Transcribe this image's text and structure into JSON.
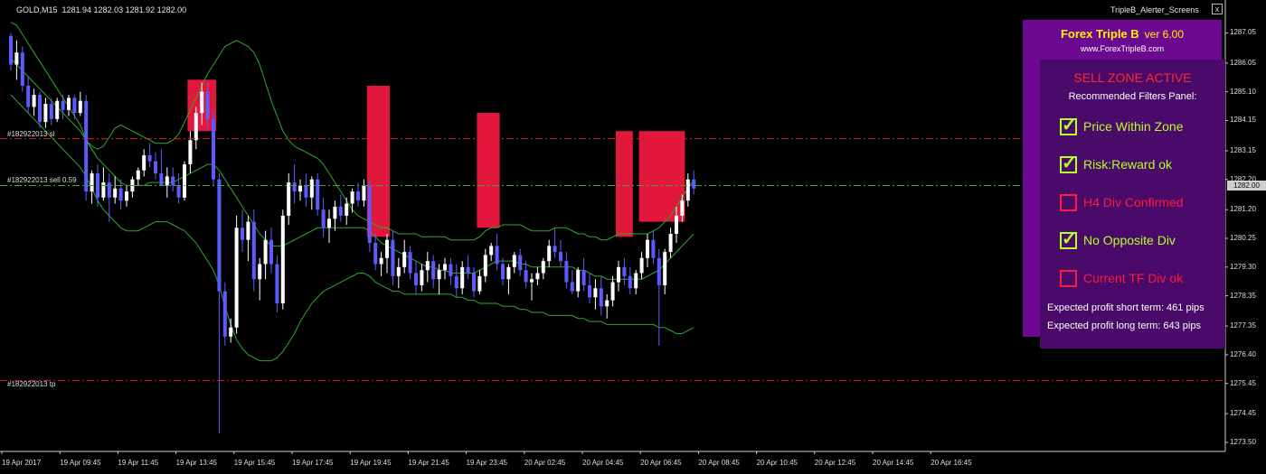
{
  "window": {
    "symbol_info": "GOLD,M15  1281.94 1282.03 1281.92 1282.00",
    "indicator_name": "TripleB_Alerter_Screens",
    "close_label": "x"
  },
  "colors": {
    "background": "#000000",
    "grid_axis": "#cccccc",
    "bull_candle": "#ffffff",
    "bear_candle": "#5b5bff",
    "bollinger": "#2ea82e",
    "sell_zone": "#e3173b",
    "sl_line": "#d62020",
    "entry_line": "#3fa33f",
    "tp_line": "#d62020",
    "panel_header_bg": "#6b0a91",
    "panel_body_bg": "#4a0a6a",
    "active_filter": "#b4ff2a",
    "inactive_filter": "#ff1a3a"
  },
  "orders": {
    "sl_label": "#182922013 sl",
    "entry_label": "#182922013 sell 0.59",
    "tp_label": "#182922013 tp"
  },
  "panel": {
    "title": "Forex Triple B",
    "version": "ver 6.00",
    "website": "www.ForexTripleB.com",
    "zone_status": "SELL ZONE ACTIVE",
    "filters_heading": "Recommended Filters Panel:",
    "filters": [
      {
        "label": "Price Within Zone",
        "checked": true
      },
      {
        "label": "Risk:Reward ok",
        "checked": true
      },
      {
        "label": "H4 Div Confirmed",
        "checked": false
      },
      {
        "label": "No Opposite Div",
        "checked": true
      },
      {
        "label": "Current TF Div ok",
        "checked": false
      }
    ],
    "profit_short": "Expected profit short term: 461 pips",
    "profit_long": "Expected profit long term: 643 pips"
  },
  "price_axis": {
    "current_price": "1282.00",
    "ticks": [
      "1287.05",
      "1286.05",
      "1285.10",
      "1284.15",
      "1283.15",
      "1282.20",
      "1281.20",
      "1280.25",
      "1279.30",
      "1278.35",
      "1277.35",
      "1276.40",
      "1275.45",
      "1274.45",
      "1273.50"
    ]
  },
  "time_axis": {
    "labels": [
      "19 Apr 2017",
      "19 Apr 09:45",
      "19 Apr 11:45",
      "19 Apr 13:45",
      "19 Apr 15:45",
      "19 Apr 17:45",
      "19 Apr 19:45",
      "19 Apr 21:45",
      "19 Apr 23:45",
      "20 Apr 02:45",
      "20 Apr 04:45",
      "20 Apr 06:45",
      "20 Apr 08:45",
      "20 Apr 10:45",
      "20 Apr 12:45",
      "20 Apr 14:45",
      "20 Apr 16:45"
    ]
  },
  "chart_data": {
    "type": "candlestick",
    "symbol": "GOLD",
    "timeframe": "M15",
    "ylim": [
      1273.2,
      1287.6
    ],
    "price_levels": {
      "stop_loss": 1283.55,
      "entry": 1282.0,
      "take_profit": 1275.55
    },
    "candles": [
      [
        1286.95,
        1287.05,
        1285.8,
        1286.0
      ],
      [
        1286.0,
        1286.8,
        1285.5,
        1286.4
      ],
      [
        1286.4,
        1286.6,
        1285.1,
        1285.3
      ],
      [
        1285.3,
        1285.6,
        1284.4,
        1284.6
      ],
      [
        1284.6,
        1285.2,
        1284.3,
        1285.0
      ],
      [
        1285.0,
        1285.1,
        1283.9,
        1284.1
      ],
      [
        1284.1,
        1284.9,
        1283.9,
        1284.7
      ],
      [
        1284.7,
        1284.9,
        1284.0,
        1284.2
      ],
      [
        1284.2,
        1284.9,
        1284.1,
        1284.8
      ],
      [
        1284.8,
        1285.0,
        1284.2,
        1284.5
      ],
      [
        1284.5,
        1285.0,
        1284.3,
        1284.9
      ],
      [
        1284.9,
        1285.0,
        1284.2,
        1284.4
      ],
      [
        1284.4,
        1285.1,
        1284.3,
        1284.8
      ],
      [
        1284.8,
        1285.0,
        1281.5,
        1281.8
      ],
      [
        1281.8,
        1282.5,
        1281.4,
        1282.4
      ],
      [
        1282.4,
        1282.7,
        1281.3,
        1281.6
      ],
      [
        1281.6,
        1282.6,
        1281.5,
        1282.1
      ],
      [
        1282.1,
        1282.4,
        1280.8,
        1281.6
      ],
      [
        1281.6,
        1282.3,
        1281.4,
        1281.9
      ],
      [
        1281.9,
        1282.2,
        1281.2,
        1281.5
      ],
      [
        1281.5,
        1282.0,
        1281.3,
        1281.8
      ],
      [
        1281.8,
        1282.3,
        1281.6,
        1282.2
      ],
      [
        1282.2,
        1282.6,
        1282.0,
        1282.5
      ],
      [
        1282.5,
        1283.2,
        1282.3,
        1283.0
      ],
      [
        1283.0,
        1283.4,
        1282.6,
        1282.8
      ],
      [
        1282.8,
        1283.1,
        1282.2,
        1282.4
      ],
      [
        1282.4,
        1283.2,
        1282.1,
        1282.0
      ],
      [
        1282.0,
        1282.6,
        1281.6,
        1282.3
      ],
      [
        1282.3,
        1282.6,
        1281.8,
        1282.0
      ],
      [
        1282.0,
        1282.4,
        1281.4,
        1281.6
      ],
      [
        1281.6,
        1282.8,
        1281.5,
        1282.7
      ],
      [
        1282.7,
        1283.8,
        1282.4,
        1283.5
      ],
      [
        1283.5,
        1284.6,
        1283.2,
        1284.4
      ],
      [
        1284.4,
        1285.4,
        1284.0,
        1285.1
      ],
      [
        1285.1,
        1285.4,
        1283.9,
        1284.2
      ],
      [
        1284.2,
        1284.5,
        1282.0,
        1282.2
      ],
      [
        1282.2,
        1282.4,
        1273.8,
        1278.5
      ],
      [
        1278.5,
        1278.8,
        1276.7,
        1277.0
      ],
      [
        1277.0,
        1277.6,
        1276.8,
        1277.3
      ],
      [
        1277.3,
        1281.0,
        1277.1,
        1280.6
      ],
      [
        1280.6,
        1281.2,
        1279.8,
        1280.2
      ],
      [
        1280.2,
        1281.0,
        1279.5,
        1280.8
      ],
      [
        1280.8,
        1281.2,
        1278.5,
        1278.9
      ],
      [
        1278.9,
        1279.6,
        1278.2,
        1279.4
      ],
      [
        1279.4,
        1280.5,
        1278.9,
        1280.2
      ],
      [
        1280.2,
        1280.6,
        1279.1,
        1279.4
      ],
      [
        1279.4,
        1279.7,
        1277.8,
        1278.1
      ],
      [
        1278.1,
        1281.2,
        1277.9,
        1281.0
      ],
      [
        1281.0,
        1282.4,
        1280.7,
        1282.1
      ],
      [
        1282.1,
        1282.7,
        1281.4,
        1281.8
      ],
      [
        1281.8,
        1282.2,
        1281.5,
        1282.0
      ],
      [
        1282.0,
        1282.4,
        1281.3,
        1281.6
      ],
      [
        1281.6,
        1282.3,
        1281.2,
        1282.2
      ],
      [
        1282.2,
        1282.4,
        1281.0,
        1281.2
      ],
      [
        1281.2,
        1281.6,
        1280.3,
        1280.6
      ],
      [
        1280.6,
        1281.2,
        1280.1,
        1280.9
      ],
      [
        1280.9,
        1281.5,
        1280.5,
        1281.3
      ],
      [
        1281.3,
        1281.7,
        1280.8,
        1281.0
      ],
      [
        1281.0,
        1281.6,
        1280.7,
        1281.4
      ],
      [
        1281.4,
        1281.9,
        1281.1,
        1281.8
      ],
      [
        1281.8,
        1282.1,
        1281.3,
        1281.5
      ],
      [
        1281.5,
        1282.2,
        1281.3,
        1282.0
      ],
      [
        1282.0,
        1282.2,
        1279.8,
        1280.1
      ],
      [
        1280.1,
        1280.4,
        1279.2,
        1279.4
      ],
      [
        1279.4,
        1279.8,
        1279.0,
        1279.6
      ],
      [
        1279.6,
        1280.4,
        1279.1,
        1280.2
      ],
      [
        1280.2,
        1280.5,
        1278.7,
        1279.0
      ],
      [
        1279.0,
        1279.6,
        1278.6,
        1279.3
      ],
      [
        1279.3,
        1280.2,
        1279.1,
        1279.8
      ],
      [
        1279.8,
        1280.0,
        1278.9,
        1279.1
      ],
      [
        1279.1,
        1279.5,
        1278.4,
        1278.7
      ],
      [
        1278.7,
        1279.4,
        1278.5,
        1279.2
      ],
      [
        1279.2,
        1279.8,
        1278.8,
        1279.5
      ],
      [
        1279.5,
        1279.7,
        1278.6,
        1278.9
      ],
      [
        1278.9,
        1279.4,
        1278.4,
        1279.2
      ],
      [
        1279.2,
        1279.6,
        1278.9,
        1279.4
      ],
      [
        1279.4,
        1279.6,
        1278.7,
        1279.0
      ],
      [
        1279.0,
        1279.4,
        1278.3,
        1278.6
      ],
      [
        1278.6,
        1279.5,
        1278.4,
        1279.3
      ],
      [
        1279.3,
        1279.7,
        1278.9,
        1279.1
      ],
      [
        1279.1,
        1279.3,
        1278.3,
        1278.5
      ],
      [
        1278.5,
        1279.2,
        1278.4,
        1279.0
      ],
      [
        1279.0,
        1279.9,
        1278.8,
        1279.7
      ],
      [
        1279.7,
        1280.1,
        1279.5,
        1280.0
      ],
      [
        1280.0,
        1280.4,
        1279.2,
        1279.4
      ],
      [
        1279.4,
        1279.6,
        1278.7,
        1278.9
      ],
      [
        1278.9,
        1279.4,
        1278.4,
        1279.3
      ],
      [
        1279.3,
        1279.8,
        1279.1,
        1279.7
      ],
      [
        1279.7,
        1279.9,
        1279.0,
        1279.2
      ],
      [
        1279.2,
        1279.5,
        1278.6,
        1278.8
      ],
      [
        1278.8,
        1279.1,
        1278.2,
        1278.9
      ],
      [
        1278.9,
        1279.3,
        1278.7,
        1279.1
      ],
      [
        1279.1,
        1279.6,
        1278.9,
        1279.5
      ],
      [
        1279.5,
        1280.2,
        1279.3,
        1280.0
      ],
      [
        1280.0,
        1280.6,
        1279.6,
        1279.8
      ],
      [
        1279.8,
        1280.2,
        1279.3,
        1279.5
      ],
      [
        1279.5,
        1279.8,
        1278.6,
        1278.8
      ],
      [
        1278.8,
        1279.2,
        1278.4,
        1278.5
      ],
      [
        1278.5,
        1279.3,
        1278.3,
        1279.2
      ],
      [
        1279.2,
        1279.6,
        1278.5,
        1278.7
      ],
      [
        1278.7,
        1279.1,
        1278.1,
        1278.3
      ],
      [
        1278.3,
        1278.9,
        1277.9,
        1278.6
      ],
      [
        1278.6,
        1279.0,
        1277.7,
        1278.0
      ],
      [
        1278.0,
        1278.4,
        1277.6,
        1278.2
      ],
      [
        1278.2,
        1279.0,
        1278.0,
        1278.8
      ],
      [
        1278.8,
        1279.5,
        1278.5,
        1279.3
      ],
      [
        1279.3,
        1279.6,
        1278.7,
        1279.0
      ],
      [
        1279.0,
        1279.3,
        1278.4,
        1278.6
      ],
      [
        1278.6,
        1279.2,
        1278.4,
        1279.1
      ],
      [
        1279.1,
        1279.8,
        1278.9,
        1279.6
      ],
      [
        1279.6,
        1280.4,
        1279.3,
        1280.2
      ],
      [
        1280.2,
        1280.5,
        1279.4,
        1279.6
      ],
      [
        1279.6,
        1279.9,
        1276.7,
        1278.7
      ],
      [
        1278.7,
        1279.9,
        1278.4,
        1279.8
      ],
      [
        1279.8,
        1280.6,
        1279.6,
        1280.4
      ],
      [
        1280.4,
        1281.3,
        1280.1,
        1281.0
      ],
      [
        1281.0,
        1281.7,
        1280.8,
        1281.5
      ],
      [
        1281.5,
        1282.4,
        1281.3,
        1282.2
      ],
      [
        1282.2,
        1282.5,
        1281.7,
        1281.9
      ]
    ],
    "bollinger": {
      "upper": [
        1287.4,
        1287.3,
        1287.0,
        1286.7,
        1286.4,
        1286.1,
        1285.8,
        1285.5,
        1285.2,
        1284.9,
        1284.6,
        1284.3,
        1284.0,
        1283.5,
        1283.3,
        1283.2,
        1283.3,
        1283.6,
        1283.9,
        1284.0,
        1283.9,
        1283.8,
        1283.7,
        1283.6,
        1283.5,
        1283.4,
        1283.4,
        1283.4,
        1283.5,
        1283.7,
        1284.1,
        1284.5,
        1284.9,
        1285.3,
        1285.7,
        1286.0,
        1286.3,
        1286.6,
        1286.7,
        1286.8,
        1286.7,
        1286.6,
        1286.4,
        1286.0,
        1285.4,
        1284.8,
        1284.3,
        1283.8,
        1283.5,
        1283.3,
        1283.2,
        1283.1,
        1283.0,
        1282.9,
        1282.7,
        1282.4,
        1282.1,
        1281.8,
        1281.5,
        1281.2,
        1281.0,
        1280.9,
        1280.8,
        1280.7,
        1280.6,
        1280.6,
        1280.5,
        1280.4,
        1280.4,
        1280.4,
        1280.4,
        1280.3,
        1280.3,
        1280.3,
        1280.3,
        1280.3,
        1280.2,
        1280.2,
        1280.2,
        1280.2,
        1280.2,
        1280.3,
        1280.5,
        1280.6,
        1280.6,
        1280.7,
        1280.7,
        1280.7,
        1280.7,
        1280.6,
        1280.5,
        1280.5,
        1280.5,
        1280.5,
        1280.6,
        1280.6,
        1280.6,
        1280.5,
        1280.4,
        1280.4,
        1280.3,
        1280.3,
        1280.2,
        1280.2,
        1280.3,
        1280.4,
        1280.4,
        1280.4,
        1280.4,
        1280.4,
        1280.4,
        1280.5,
        1280.6,
        1280.8,
        1281.0,
        1281.3,
        1281.6,
        1281.9,
        1282.2
      ],
      "middle": [
        1286.2,
        1286.0,
        1285.8,
        1285.6,
        1285.4,
        1285.2,
        1285.0,
        1284.8,
        1284.6,
        1284.4,
        1284.2,
        1284.0,
        1283.8,
        1283.5,
        1283.2,
        1282.9,
        1282.7,
        1282.5,
        1282.3,
        1282.1,
        1282.0,
        1282.0,
        1282.0,
        1282.0,
        1282.1,
        1282.1,
        1282.1,
        1282.1,
        1282.1,
        1282.2,
        1282.3,
        1282.4,
        1282.5,
        1282.6,
        1282.7,
        1282.7,
        1282.5,
        1282.2,
        1281.9,
        1281.6,
        1281.3,
        1281.0,
        1280.7,
        1280.4,
        1280.2,
        1280.0,
        1280.0,
        1280.0,
        1280.1,
        1280.2,
        1280.3,
        1280.4,
        1280.5,
        1280.6,
        1280.6,
        1280.6,
        1280.6,
        1280.6,
        1280.6,
        1280.6,
        1280.6,
        1280.6,
        1280.5,
        1280.3,
        1280.1,
        1280.0,
        1279.9,
        1279.8,
        1279.7,
        1279.6,
        1279.5,
        1279.4,
        1279.3,
        1279.3,
        1279.2,
        1279.2,
        1279.1,
        1279.1,
        1279.1,
        1279.1,
        1279.1,
        1279.2,
        1279.3,
        1279.4,
        1279.5,
        1279.5,
        1279.5,
        1279.5,
        1279.4,
        1279.4,
        1279.3,
        1279.3,
        1279.3,
        1279.3,
        1279.3,
        1279.3,
        1279.3,
        1279.3,
        1279.2,
        1279.2,
        1279.1,
        1279.0,
        1279.0,
        1278.9,
        1278.9,
        1278.9,
        1278.9,
        1278.9,
        1278.9,
        1278.9,
        1279.0,
        1279.1,
        1279.2,
        1279.4,
        1279.6,
        1279.8,
        1280.0,
        1280.2,
        1280.4
      ],
      "lower": [
        1285.0,
        1284.8,
        1284.6,
        1284.4,
        1284.2,
        1284.0,
        1283.8,
        1283.6,
        1283.4,
        1283.2,
        1283.0,
        1282.8,
        1282.6,
        1282.3,
        1281.9,
        1281.5,
        1281.2,
        1281.0,
        1280.8,
        1280.6,
        1280.5,
        1280.5,
        1280.5,
        1280.6,
        1280.7,
        1280.8,
        1280.8,
        1280.8,
        1280.7,
        1280.6,
        1280.5,
        1280.3,
        1280.1,
        1279.8,
        1279.5,
        1279.2,
        1278.7,
        1278.0,
        1277.4,
        1276.9,
        1276.6,
        1276.4,
        1276.3,
        1276.2,
        1276.2,
        1276.2,
        1276.3,
        1276.5,
        1276.8,
        1277.1,
        1277.5,
        1277.8,
        1278.1,
        1278.3,
        1278.5,
        1278.6,
        1278.7,
        1278.8,
        1278.9,
        1279.0,
        1279.1,
        1279.1,
        1279.0,
        1278.8,
        1278.7,
        1278.6,
        1278.5,
        1278.5,
        1278.4,
        1278.4,
        1278.4,
        1278.4,
        1278.4,
        1278.4,
        1278.4,
        1278.4,
        1278.4,
        1278.3,
        1278.3,
        1278.2,
        1278.2,
        1278.1,
        1278.1,
        1278.1,
        1278.1,
        1278.0,
        1278.0,
        1278.0,
        1277.9,
        1277.9,
        1277.8,
        1277.8,
        1277.8,
        1277.7,
        1277.7,
        1277.7,
        1277.7,
        1277.7,
        1277.6,
        1277.6,
        1277.5,
        1277.5,
        1277.5,
        1277.4,
        1277.4,
        1277.4,
        1277.4,
        1277.4,
        1277.4,
        1277.4,
        1277.4,
        1277.4,
        1277.3,
        1277.3,
        1277.2,
        1277.1,
        1277.1,
        1277.2,
        1277.3
      ]
    },
    "sell_zones": [
      {
        "from_bar": 31,
        "to_bar": 35,
        "top": 1285.5,
        "bottom": 1283.8
      },
      {
        "from_bar": 62,
        "to_bar": 65,
        "top": 1285.3,
        "bottom": 1280.3
      },
      {
        "from_bar": 81,
        "to_bar": 84,
        "top": 1284.4,
        "bottom": 1280.6
      },
      {
        "from_bar": 105,
        "to_bar": 107,
        "top": 1283.8,
        "bottom": 1280.3
      },
      {
        "from_bar": 109,
        "to_bar": 116,
        "top": 1283.8,
        "bottom": 1280.8
      }
    ]
  }
}
